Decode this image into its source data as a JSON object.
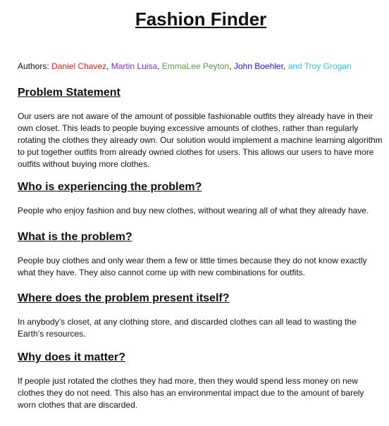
{
  "title": "Fashion Finder",
  "authors": {
    "label": "Authors: ",
    "names": [
      {
        "text": "Daniel Chavez",
        "color": "#e02020"
      },
      {
        "text": "Martin Luisa",
        "color": "#8a2be2"
      },
      {
        "text": "EmmaLee Peyton",
        "color": "#5a9a4a"
      },
      {
        "text": "John Boehler",
        "color": "#1a1acc"
      },
      {
        "text": "and Troy Grogan",
        "color": "#22ccdd"
      }
    ],
    "separator": ", "
  },
  "sections": [
    {
      "heading": "Problem Statement",
      "body": "Our users are not aware of the amount of possible fashionable outfits they already have in their own closet. This leads to people buying excessive amounts of clothes, rather than regularly rotating the clothes they already own. Our solution would implement a machine learning algorithm to put together outfits from already owned clothes for users. This allows our users to have more outfits without buying more clothes."
    },
    {
      "heading": "Who is experiencing the problem?",
      "body": "People who enjoy fashion and buy new clothes, without wearing all of what they already have."
    },
    {
      "heading": "What is the problem?",
      "body": "People buy clothes and only wear them a few or little times because they do not know exactly what they have. They also cannot come up with new combinations for outfits."
    },
    {
      "heading": "Where does the problem present itself?",
      "body": "In anybody’s closet, at any clothing store, and discarded clothes can all lead to wasting the Earth’s resources."
    },
    {
      "heading": "Why does it matter?",
      "body": "If people just rotated the clothes they had more, then they would spend less money on new clothes they do not need. This also has an environmental impact due to the amount of barely worn clothes that are discarded."
    }
  ]
}
